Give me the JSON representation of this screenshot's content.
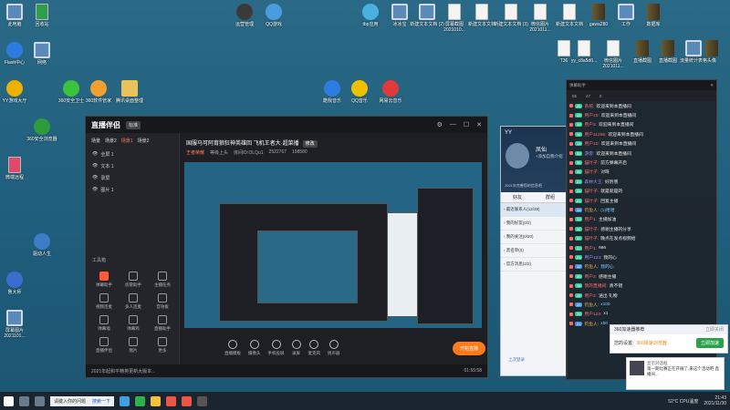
{
  "desktop": {
    "left_icons": [
      "此电脑",
      "回收站",
      "Flash中心",
      "网络",
      "YY游戏大厅",
      "360安全卫士",
      "360软件管家",
      "腾讯桌面整理",
      "360安全浏览器",
      "微端远程",
      "驱动人生",
      "鲁大师",
      "屏幕图片 2021101..."
    ],
    "top_icons": [
      "运营管理",
      "QQ游戏",
      "tbp应用",
      "冰冰宝",
      "新建文本文档 (2)",
      "屏幕截图 2021010...",
      "新建文本文档",
      "新建文本文档 (3)",
      "微信图片 2021011...",
      "新建文本文档",
      "gawa280",
      "工作",
      "数据库"
    ],
    "mid_icons": [
      "酷我音乐",
      "QQ音乐",
      "网易云音乐"
    ],
    "right_icons": [
      "T36",
      "yy_c8a5d6...",
      "微信图片 2021011...",
      "直播截图",
      "直播截图",
      "流量统计表格",
      "头像"
    ]
  },
  "live_window": {
    "app_name": "直播伴侣",
    "version": "标准",
    "scene_tabs": [
      "场景",
      "场景2",
      "场景1",
      "场景2"
    ],
    "sources": [
      "全屏 1",
      "文本 1",
      "录屏",
      "图片 1"
    ],
    "tools_title": "工具箱",
    "tools": [
      "弹幕助手",
      "房管助手",
      "主播任务",
      "视频连麦",
      "多人连麦",
      "音效板",
      "弹幕墙",
      "弹幕鸡",
      "直播助手",
      "直播伴侣",
      "图片",
      "更多"
    ],
    "stream_title": "国服马可阿育狼狂神英雄回 飞机王者大·超菜播",
    "title_tag": "修改",
    "room_tag": "王者荣耀",
    "room_sub": "等级上头",
    "room_id": "房间ID:OLQu1",
    "fans": "2522767",
    "popularity": "198580",
    "bottom_buttons": [
      "直播模板",
      "摄像头",
      "手机投屏",
      "录屏",
      "麦克风",
      "扬声器"
    ],
    "start_button": "开始直播",
    "notice": "2021年起和平精英更新大版本...",
    "timer": "01:55:58"
  },
  "yy_window": {
    "title": "YY",
    "nick": "凤仙",
    "signature": "+添加自我介绍",
    "footer": "2021年完善您的信息吧",
    "tabs": [
      "好友",
      "群组"
    ],
    "groups": [
      "最近联系人(12/38)",
      "我的好友(0/2)",
      "我的关注(0/20)",
      "黑名单(0)",
      "官方消息(2/2)"
    ],
    "bottom": "上次登录"
  },
  "danmaku": {
    "title": "弹幕助手",
    "stats": [
      "55",
      "47",
      "0"
    ],
    "messages": [
      {
        "lv": "25",
        "user": "系统",
        "text": "欢迎来到本直播间",
        "type": "r"
      },
      {
        "lv": "25",
        "user": "用户10",
        "text": "欢迎来到本直播间",
        "type": "r"
      },
      {
        "lv": "15",
        "user": "用户2",
        "text": "欢迎来到本直播间",
        "type": "r"
      },
      {
        "lv": "10",
        "user": "用户11256",
        "text": "欢迎来到本直播间",
        "type": "r"
      },
      {
        "lv": "13",
        "user": "用户10",
        "text": "欢迎来到本直播间",
        "type": "r"
      },
      {
        "lv": "32",
        "user": "游客",
        "text": "欢迎来到本直播间",
        "type": "p"
      },
      {
        "lv": "36",
        "user": "猫叶子",
        "text": "前方弹幕开启",
        "type": "r"
      },
      {
        "lv": "34",
        "user": "猫叶子",
        "text": "对呀",
        "type": "r"
      },
      {
        "lv": "21",
        "user": "森林大王",
        "text": "好厉害",
        "type": "p"
      },
      {
        "lv": "24",
        "user": "猫叶子",
        "text": "就是就是的",
        "type": "r"
      },
      {
        "lv": "24",
        "user": "猫叶子",
        "text": "回复主播",
        "type": "r"
      },
      {
        "lv": "14",
        "user": "钓鱼人",
        "text": "(1)哈哈",
        "type": "b"
      },
      {
        "lv": "13",
        "user": "用户1",
        "text": "主播加油",
        "type": "r"
      },
      {
        "lv": "30",
        "user": "猫叶子",
        "text": "感谢主播的分享",
        "type": "r"
      },
      {
        "lv": "31",
        "user": "猫叶子",
        "text": "晚点在发点视频给",
        "type": "r"
      },
      {
        "lv": "22",
        "user": "用户1",
        "text": "666",
        "type": "r"
      },
      {
        "lv": "23",
        "user": "用户123",
        "text": "我的心",
        "type": "p"
      },
      {
        "lv": "12",
        "user": "钓鱼人",
        "text": "我的心",
        "type": "b"
      },
      {
        "lv": "30",
        "user": "用户2",
        "text": "感谢主播",
        "type": "r"
      },
      {
        "lv": "15",
        "user": "我的直播间",
        "text": "真不错",
        "type": "r"
      },
      {
        "lv": "19",
        "user": "用户2",
        "text": "送出 礼物",
        "type": "r"
      },
      {
        "lv": "20",
        "user": "钓鱼人",
        "text": "x100",
        "type": "b"
      },
      {
        "lv": "25",
        "user": "用户123",
        "text": "x1",
        "type": "r"
      },
      {
        "lv": "21",
        "user": "钓鱼人",
        "text": "x50",
        "type": "b"
      }
    ]
  },
  "popup1": {
    "title": "360加速器推荐",
    "close": "立即关闭",
    "msg": "您的设置:",
    "msg_highlight": "360极速浏览器",
    "button": "立即加速"
  },
  "popup2": {
    "name": "显示对话框",
    "text": "第一期比赛正在开展了,来这个活动吧  直播间..."
  },
  "taskbar": {
    "search": "请键入你的问题",
    "search_btn": "搜索一下",
    "temp": "52°C",
    "temp_label": "CPU温度",
    "time": "21:43",
    "date": "2021/11/30"
  }
}
